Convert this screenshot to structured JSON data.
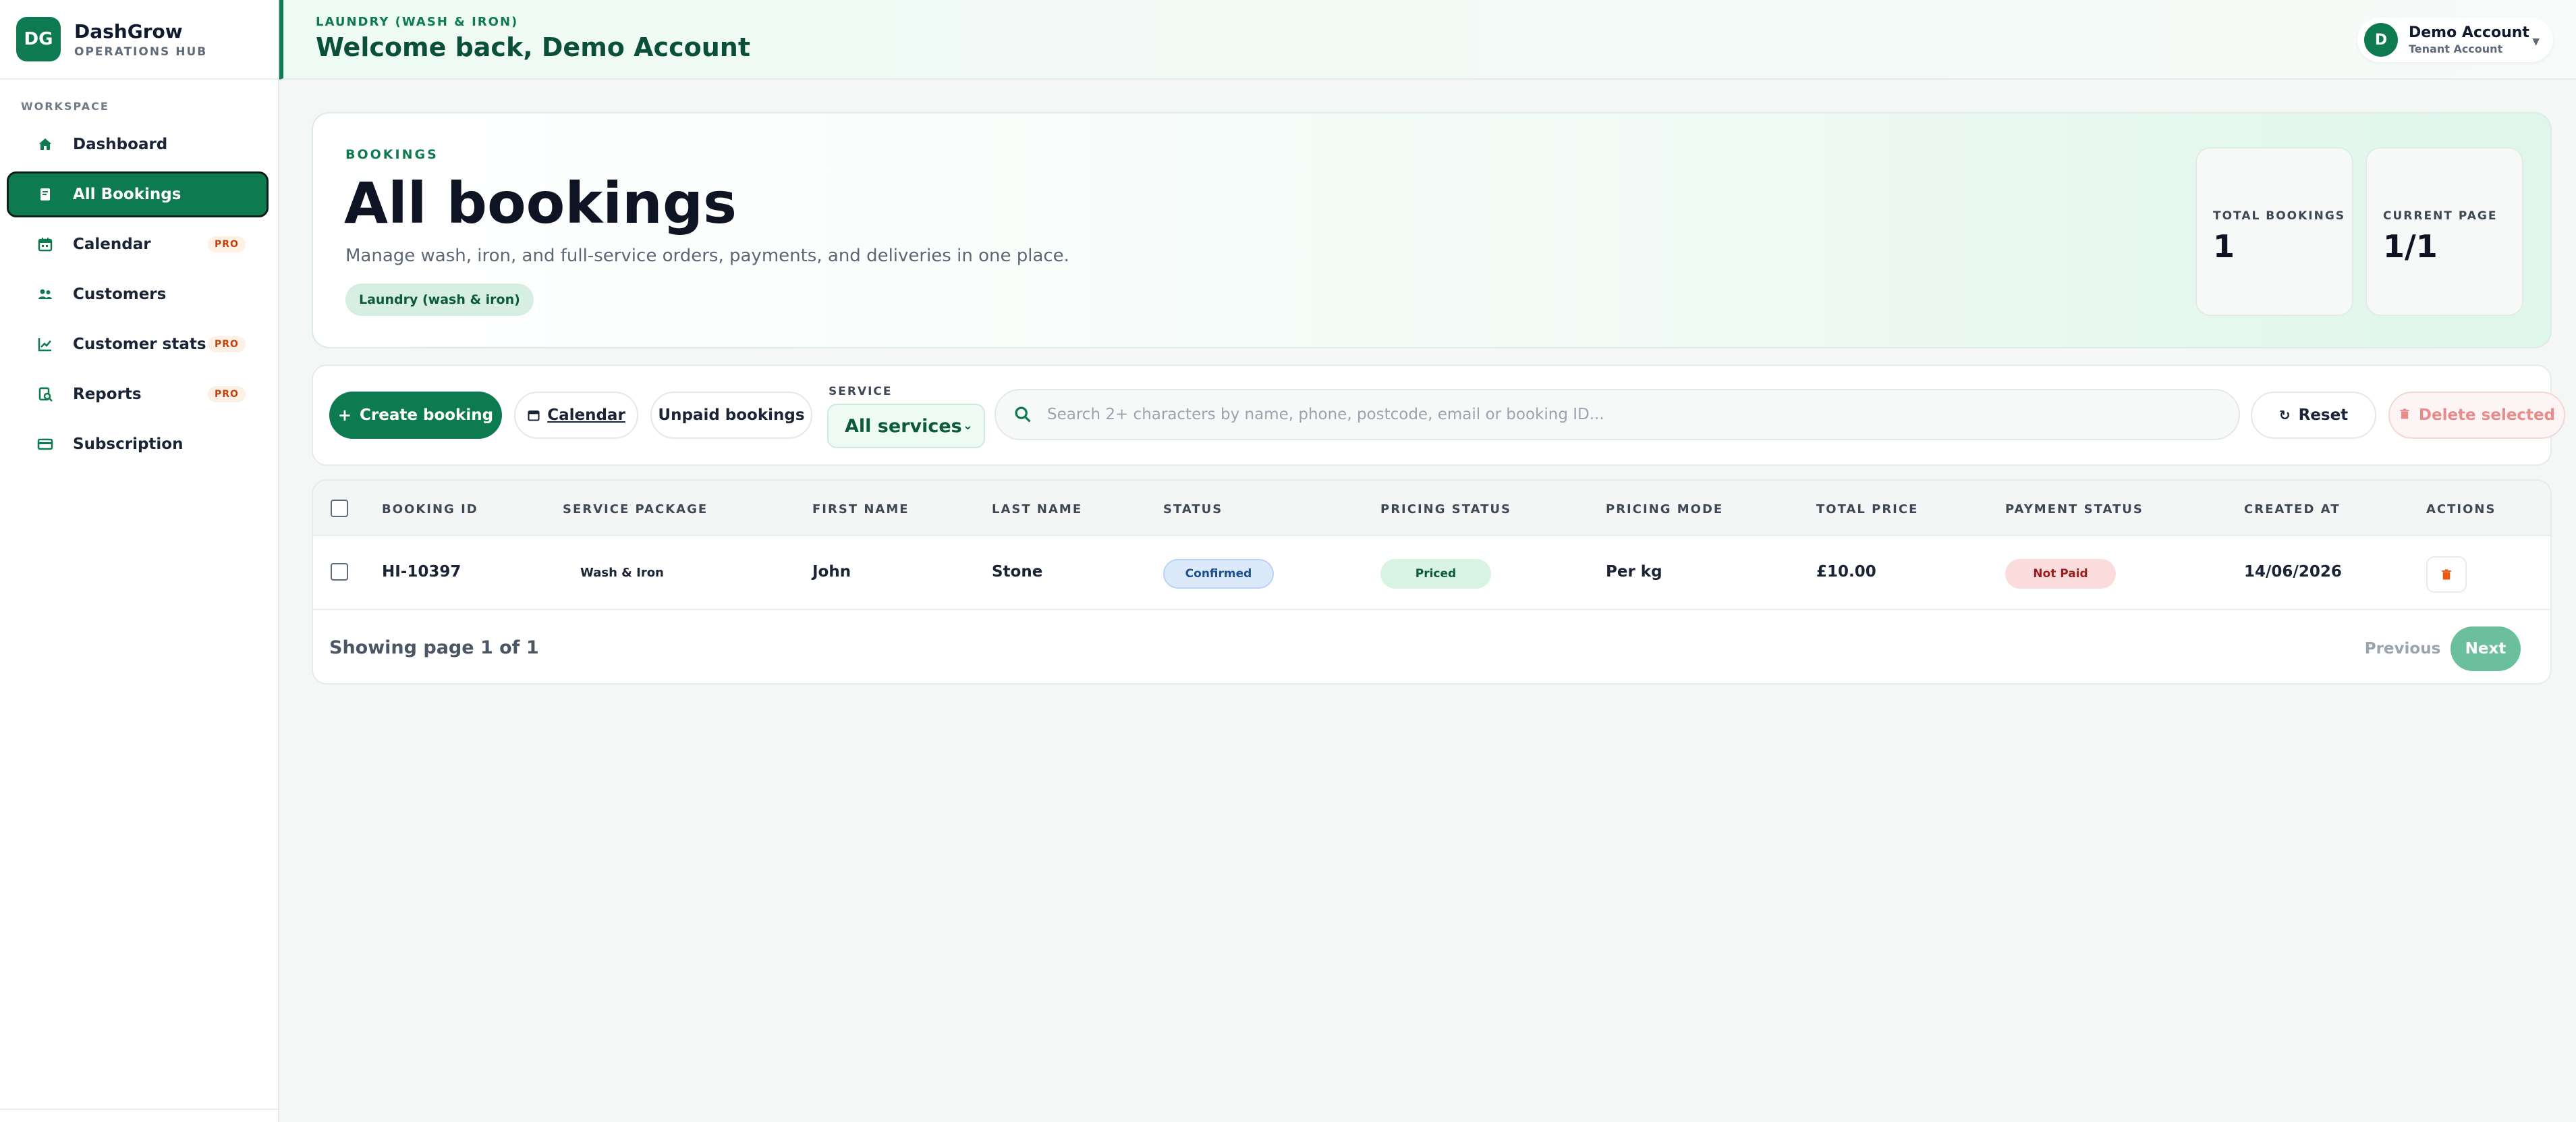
{
  "brand": {
    "logo": "DG",
    "name": "DashGrow",
    "sub": "OPERATIONS HUB"
  },
  "sidebar": {
    "section_label": "WORKSPACE",
    "items": [
      {
        "label": "Dashboard",
        "icon": "home-icon",
        "pro": ""
      },
      {
        "label": "All Bookings",
        "icon": "book-icon",
        "pro": "",
        "active": true
      },
      {
        "label": "Calendar",
        "icon": "calendar-icon",
        "pro": "PRO"
      },
      {
        "label": "Customers",
        "icon": "users-icon",
        "pro": ""
      },
      {
        "label": "Customer stats",
        "icon": "chart-line-icon",
        "pro": "PRO"
      },
      {
        "label": "Reports",
        "icon": "report-search-icon",
        "pro": "PRO"
      },
      {
        "label": "Subscription",
        "icon": "credit-card-icon",
        "pro": ""
      }
    ]
  },
  "header": {
    "crumb": "LAUNDRY (WASH & IRON)",
    "welcome": "Welcome back, Demo Account",
    "account": {
      "avatar": "D",
      "name": "Demo Account",
      "role": "Tenant Account"
    }
  },
  "hero": {
    "eyebrow": "BOOKINGS",
    "title": "All bookings",
    "description": "Manage wash, iron, and full-service orders, payments, and deliveries in one place.",
    "chip": "Laundry (wash & iron)",
    "stats": [
      {
        "label": "TOTAL BOOKINGS",
        "value": "1"
      },
      {
        "label": "CURRENT PAGE",
        "value": "1/1"
      }
    ]
  },
  "toolbar": {
    "create_label": "Create booking",
    "calendar_label": "Calendar",
    "unpaid_label": "Unpaid bookings",
    "service_label": "SERVICE",
    "service_value": "All services",
    "search_placeholder": "Search 2+ characters by name, phone, postcode, email or booking ID...",
    "reset_label": "Reset",
    "delete_label": "Delete selected"
  },
  "table": {
    "columns": [
      "BOOKING ID",
      "SERVICE PACKAGE",
      "FIRST NAME",
      "LAST NAME",
      "STATUS",
      "PRICING STATUS",
      "PRICING MODE",
      "TOTAL PRICE",
      "PAYMENT STATUS",
      "CREATED AT",
      "ACTIONS"
    ],
    "rows": [
      {
        "booking_id": "HI-10397",
        "service_package": "Wash & Iron",
        "first_name": "John",
        "last_name": "Stone",
        "status": "Confirmed",
        "pricing_status": "Priced",
        "pricing_mode": "Per kg",
        "total_price": "£10.00",
        "payment_status": "Not Paid",
        "created_at": "14/06/2026"
      }
    ]
  },
  "pagination": {
    "summary": "Showing page 1 of 1",
    "prev_label": "Previous",
    "next_label": "Next"
  },
  "colors": {
    "brand": "#0d7a4f",
    "accent_light": "#eefaf4",
    "pro": "#c2410c",
    "danger": "#e78b8b"
  }
}
